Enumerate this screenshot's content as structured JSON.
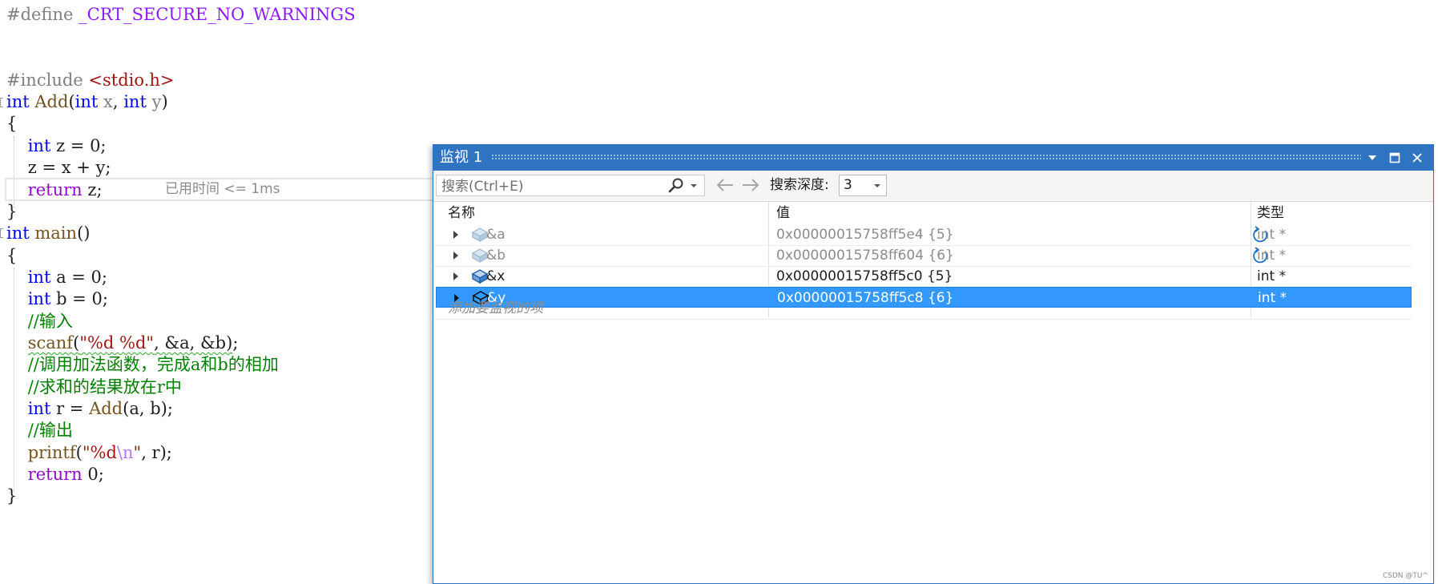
{
  "editor": {
    "tokens": {
      "hash_define": "#define",
      "macro_name": "_CRT_SECURE_NO_WARNINGS",
      "hash_include": "#include",
      "header": "<stdio.h>",
      "kw_int": "int",
      "fn_add": "Add",
      "fn_main": "main",
      "fn_scanf": "scanf",
      "fn_printf": "printf",
      "kw_return": "return",
      "param_x": "x",
      "param_y": "y",
      "comment_input": "//输入",
      "comment_call": "//调用加法函数，完成a和b的相加",
      "comment_store": "//求和的结果放在r中",
      "comment_output": "//输出",
      "fmt_scanf": "\"%d %d\"",
      "fmt_printf_a": "\"%d",
      "fmt_printf_esc": "\\n",
      "fmt_printf_b": "\"",
      "perf_tip": "已用时间 <= 1ms"
    }
  },
  "watch": {
    "title": "监视 1",
    "search_placeholder": "搜索(Ctrl+E)",
    "depth_label": "搜索深度:",
    "depth_value": "3",
    "columns": {
      "name": "名称",
      "value": "值",
      "type": "类型"
    },
    "rows": [
      {
        "name": "&a",
        "value": "0x00000015758ff5e4 {5}",
        "type": "int *"
      },
      {
        "name": "&b",
        "value": "0x00000015758ff604 {6}",
        "type": "int *"
      },
      {
        "name": "&x",
        "value": "0x00000015758ff5c0 {5}",
        "type": "int *"
      },
      {
        "name": "&y",
        "value": "0x00000015758ff5c8 {6}",
        "type": "int *"
      }
    ],
    "add_item": "添加要监视的项",
    "watermark": "CSDN @TU^"
  },
  "colors": {
    "accent": "#2f74c1",
    "selection": "#3399ff",
    "keyword": "#0000ff",
    "comment": "#008000",
    "string": "#a31515"
  }
}
